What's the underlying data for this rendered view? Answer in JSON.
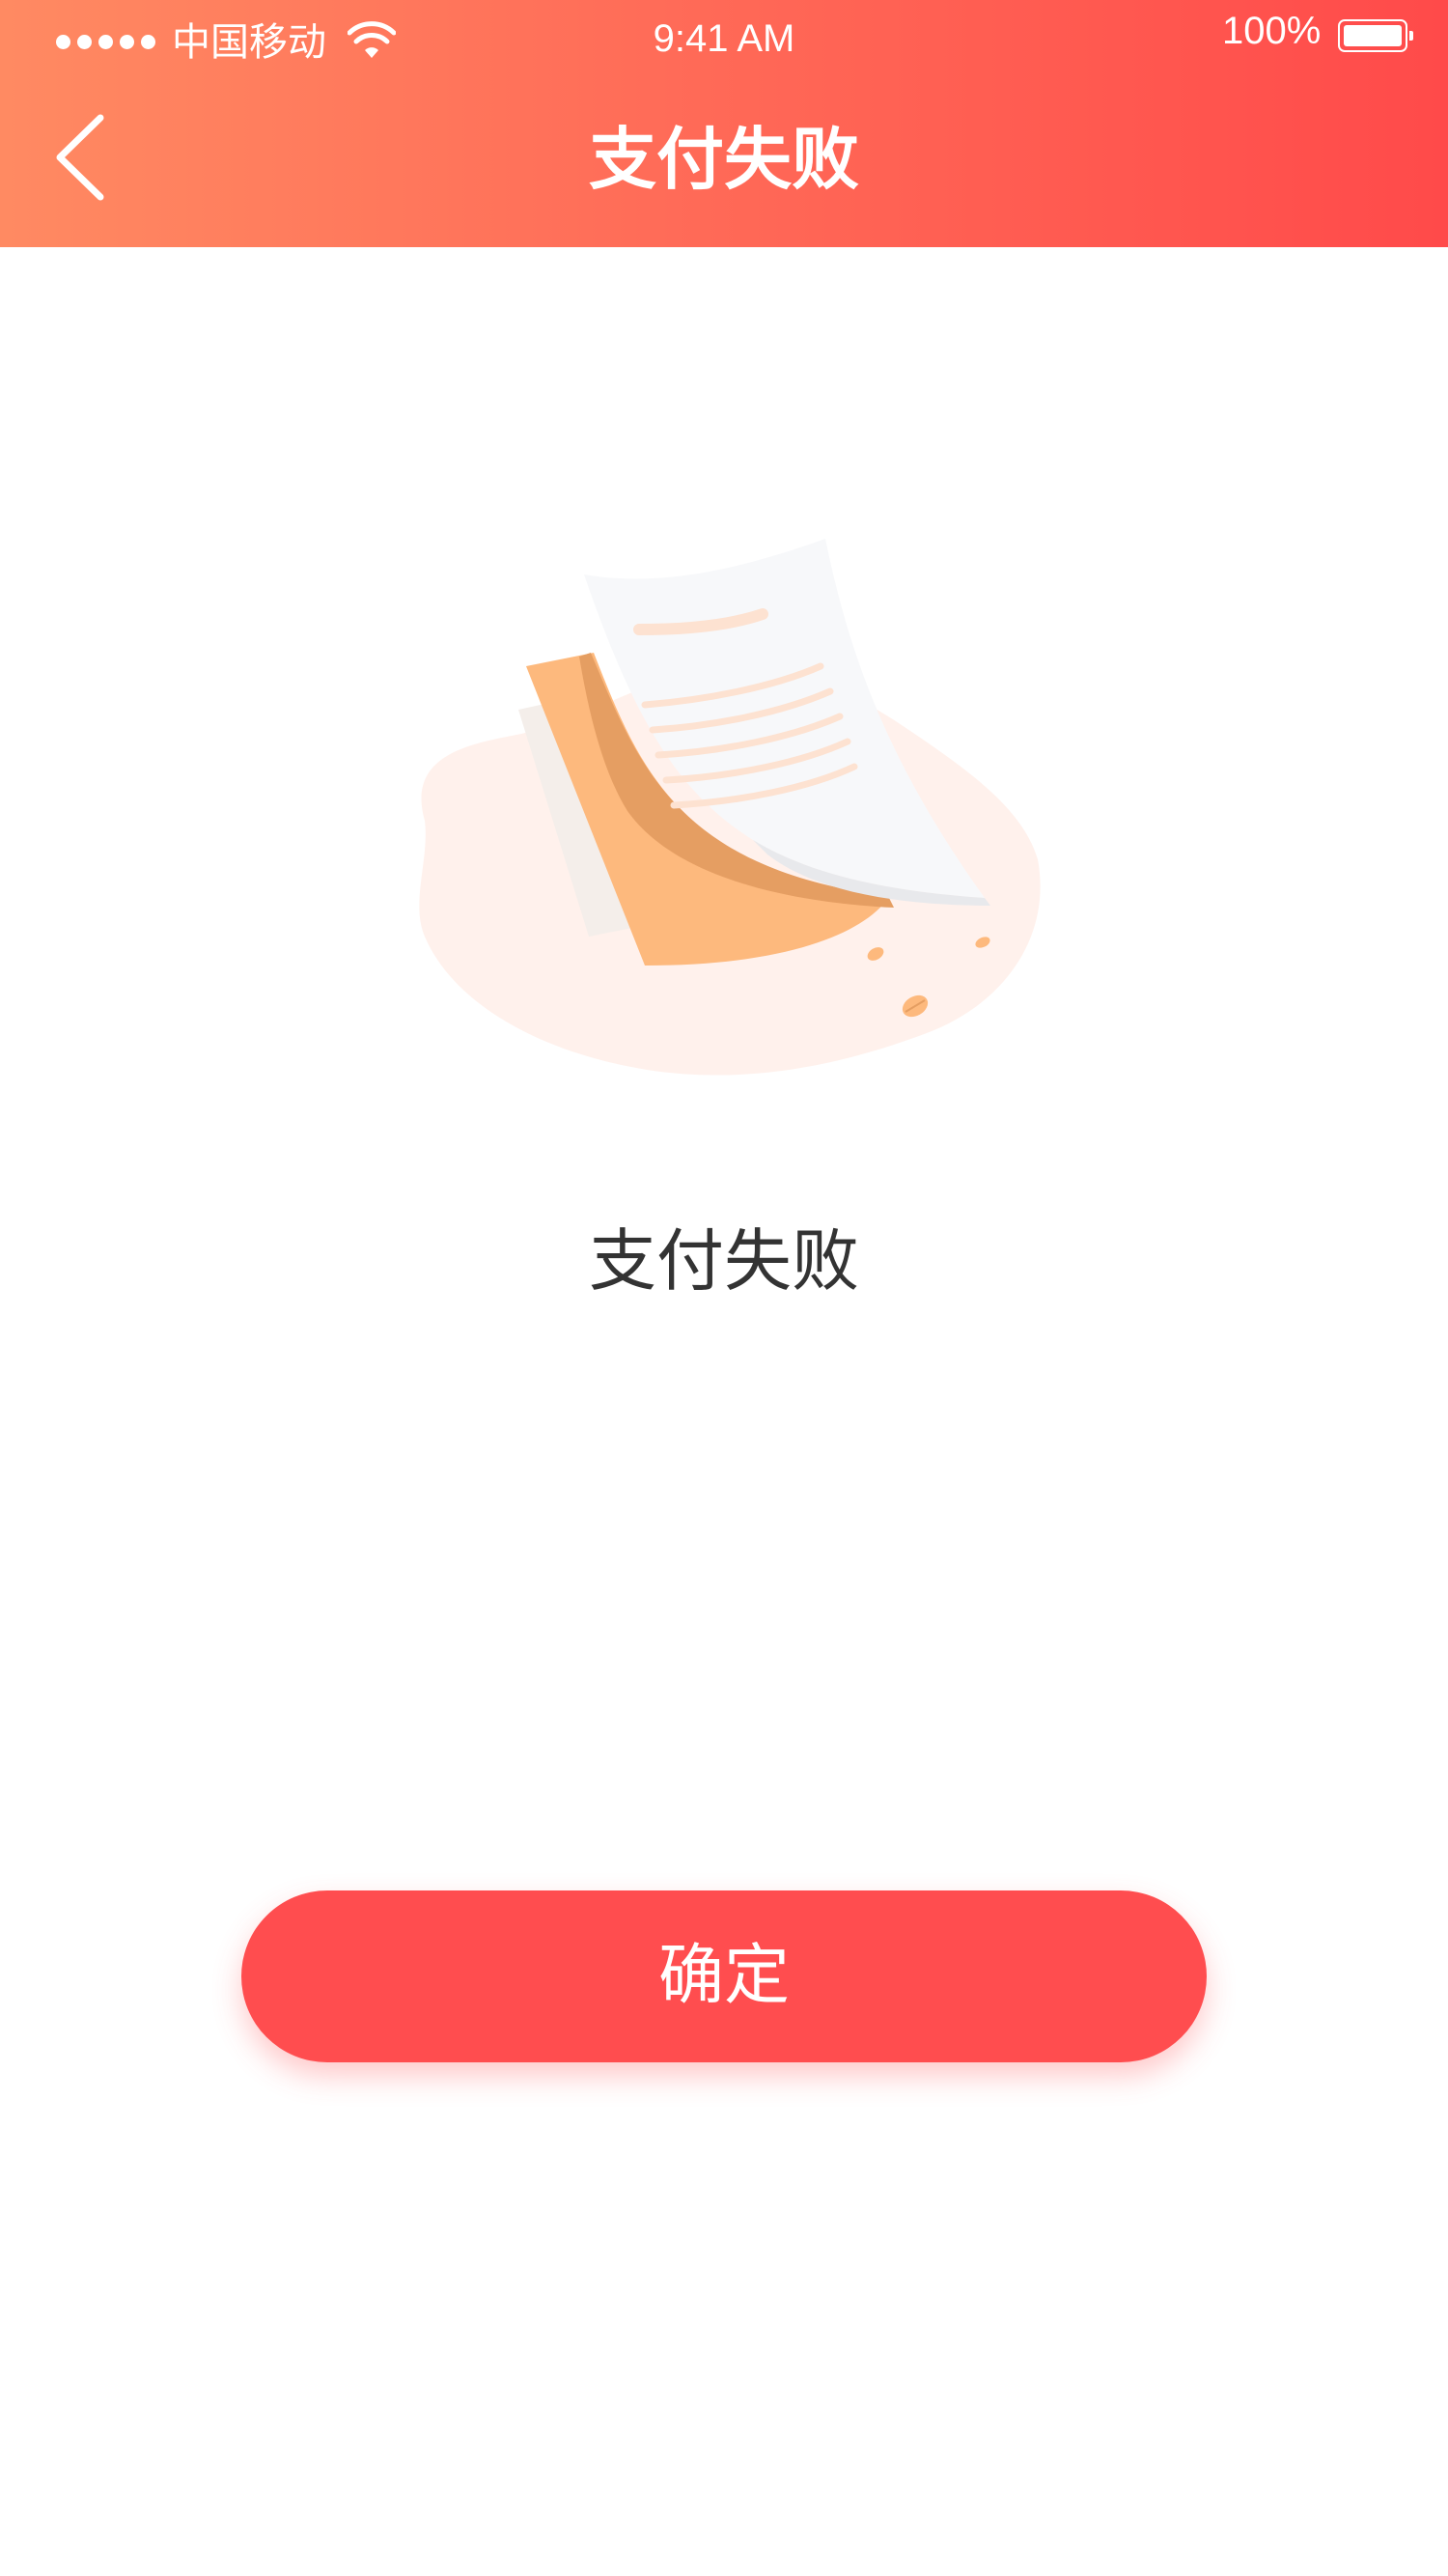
{
  "status_bar": {
    "carrier": "中国移动",
    "time": "9:41 AM",
    "battery_percent": "100%",
    "battery_level": 1.0,
    "wifi_icon": "wifi-icon"
  },
  "nav": {
    "title": "支付失败",
    "back_icon": "chevron-left-icon"
  },
  "illustration": {
    "name": "failed-receipt-illustration"
  },
  "message": "支付失败",
  "confirm_button": {
    "label": "确定"
  },
  "colors": {
    "header_gradient_start": "#FF8A62",
    "header_gradient_end": "#FF4A4A",
    "button": "#FF4D4F",
    "message_text": "#333333"
  }
}
